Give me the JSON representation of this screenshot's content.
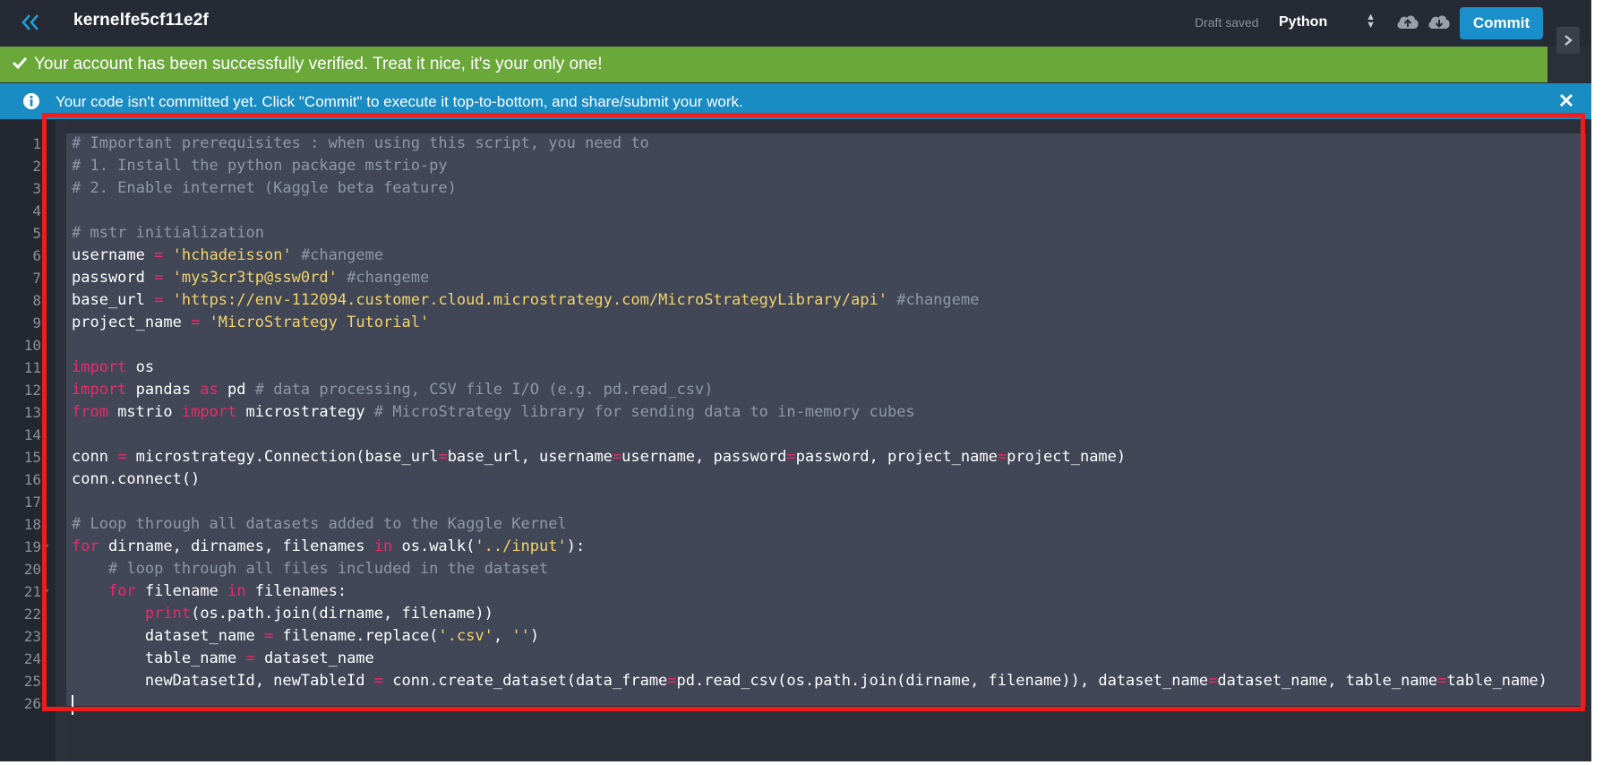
{
  "header": {
    "kernel_title": "kernelfe5cf11e2f",
    "draft_status": "Draft saved",
    "language": "Python",
    "commit_label": "Commit"
  },
  "banners": {
    "success": "Your account has been successfully verified. Treat it nice, it's your only one!",
    "info": "Your code isn't committed yet. Click \"Commit\" to execute it top-to-bottom, and share/submit your work."
  },
  "editor": {
    "lines": [
      {
        "n": "1",
        "tokens": [
          {
            "c": "# Important prerequisites : when using this script, you need to",
            "t": "c"
          }
        ]
      },
      {
        "n": "2",
        "tokens": [
          {
            "c": "# 1. Install the python package mstrio-py",
            "t": "c"
          }
        ]
      },
      {
        "n": "3",
        "tokens": [
          {
            "c": "# 2. Enable internet (Kaggle beta feature)",
            "t": "c"
          }
        ]
      },
      {
        "n": "4",
        "tokens": []
      },
      {
        "n": "5",
        "tokens": [
          {
            "c": "# mstr initialization",
            "t": "c"
          }
        ]
      },
      {
        "n": "6",
        "tokens": [
          {
            "c": "username ",
            "t": "p"
          },
          {
            "c": "=",
            "t": "o"
          },
          {
            "c": " ",
            "t": "p"
          },
          {
            "c": "'hchadeisson'",
            "t": "s"
          },
          {
            "c": " ",
            "t": "p"
          },
          {
            "c": "#changeme",
            "t": "c"
          }
        ]
      },
      {
        "n": "7",
        "tokens": [
          {
            "c": "password ",
            "t": "p"
          },
          {
            "c": "=",
            "t": "o"
          },
          {
            "c": " ",
            "t": "p"
          },
          {
            "c": "'mys3cr3tp@ssw0rd'",
            "t": "s"
          },
          {
            "c": " ",
            "t": "p"
          },
          {
            "c": "#changeme",
            "t": "c"
          }
        ]
      },
      {
        "n": "8",
        "tokens": [
          {
            "c": "base_url ",
            "t": "p"
          },
          {
            "c": "=",
            "t": "o"
          },
          {
            "c": " ",
            "t": "p"
          },
          {
            "c": "'https://env-112094.customer.cloud.microstrategy.com/MicroStrategyLibrary/api'",
            "t": "s"
          },
          {
            "c": " ",
            "t": "p"
          },
          {
            "c": "#changeme",
            "t": "c"
          }
        ]
      },
      {
        "n": "9",
        "tokens": [
          {
            "c": "project_name ",
            "t": "p"
          },
          {
            "c": "=",
            "t": "o"
          },
          {
            "c": " ",
            "t": "p"
          },
          {
            "c": "'MicroStrategy Tutorial'",
            "t": "s"
          }
        ]
      },
      {
        "n": "10",
        "tokens": []
      },
      {
        "n": "11",
        "tokens": [
          {
            "c": "import",
            "t": "k"
          },
          {
            "c": " os",
            "t": "p"
          }
        ]
      },
      {
        "n": "12",
        "tokens": [
          {
            "c": "import",
            "t": "k"
          },
          {
            "c": " pandas ",
            "t": "p"
          },
          {
            "c": "as",
            "t": "k"
          },
          {
            "c": " pd ",
            "t": "p"
          },
          {
            "c": "# data processing, CSV file I/O (e.g. pd.read_csv)",
            "t": "c"
          }
        ]
      },
      {
        "n": "13",
        "tokens": [
          {
            "c": "from",
            "t": "k"
          },
          {
            "c": " mstrio ",
            "t": "p"
          },
          {
            "c": "import",
            "t": "k"
          },
          {
            "c": " microstrategy ",
            "t": "p"
          },
          {
            "c": "# MicroStrategy library for sending data to in-memory cubes",
            "t": "c"
          }
        ]
      },
      {
        "n": "14",
        "tokens": []
      },
      {
        "n": "15",
        "tokens": [
          {
            "c": "conn ",
            "t": "p"
          },
          {
            "c": "=",
            "t": "o"
          },
          {
            "c": " microstrategy.Connection(base_url",
            "t": "p"
          },
          {
            "c": "=",
            "t": "o"
          },
          {
            "c": "base_url, username",
            "t": "p"
          },
          {
            "c": "=",
            "t": "o"
          },
          {
            "c": "username, password",
            "t": "p"
          },
          {
            "c": "=",
            "t": "o"
          },
          {
            "c": "password, project_name",
            "t": "p"
          },
          {
            "c": "=",
            "t": "o"
          },
          {
            "c": "project_name)",
            "t": "p"
          }
        ]
      },
      {
        "n": "16",
        "tokens": [
          {
            "c": "conn.connect()",
            "t": "p"
          }
        ]
      },
      {
        "n": "17",
        "tokens": []
      },
      {
        "n": "18",
        "tokens": [
          {
            "c": "# Loop through all datasets added to the Kaggle Kernel",
            "t": "c"
          }
        ]
      },
      {
        "n": "19",
        "tokens": [
          {
            "c": "for",
            "t": "k"
          },
          {
            "c": " dirname, dirnames, filenames ",
            "t": "p"
          },
          {
            "c": "in",
            "t": "k"
          },
          {
            "c": " os.walk(",
            "t": "p"
          },
          {
            "c": "'../input'",
            "t": "s"
          },
          {
            "c": "):",
            "t": "p"
          }
        ]
      },
      {
        "n": "20",
        "tokens": [
          {
            "c": "    ",
            "t": "p"
          },
          {
            "c": "# loop through all files included in the dataset",
            "t": "c"
          }
        ]
      },
      {
        "n": "21",
        "tokens": [
          {
            "c": "    ",
            "t": "p"
          },
          {
            "c": "for",
            "t": "k"
          },
          {
            "c": " filename ",
            "t": "p"
          },
          {
            "c": "in",
            "t": "k"
          },
          {
            "c": " filenames:",
            "t": "p"
          }
        ]
      },
      {
        "n": "22",
        "tokens": [
          {
            "c": "        ",
            "t": "p"
          },
          {
            "c": "print",
            "t": "k"
          },
          {
            "c": "(os.path.join(dirname, filename))",
            "t": "p"
          }
        ]
      },
      {
        "n": "23",
        "tokens": [
          {
            "c": "        dataset_name ",
            "t": "p"
          },
          {
            "c": "=",
            "t": "o"
          },
          {
            "c": " filename.replace(",
            "t": "p"
          },
          {
            "c": "'.csv'",
            "t": "s"
          },
          {
            "c": ", ",
            "t": "p"
          },
          {
            "c": "''",
            "t": "s"
          },
          {
            "c": ")",
            "t": "p"
          }
        ]
      },
      {
        "n": "24",
        "tokens": [
          {
            "c": "        table_name ",
            "t": "p"
          },
          {
            "c": "=",
            "t": "o"
          },
          {
            "c": " dataset_name",
            "t": "p"
          }
        ]
      },
      {
        "n": "25",
        "tokens": [
          {
            "c": "        newDatasetId, newTableId ",
            "t": "p"
          },
          {
            "c": "=",
            "t": "o"
          },
          {
            "c": " conn.create_dataset(data_frame",
            "t": "p"
          },
          {
            "c": "=",
            "t": "o"
          },
          {
            "c": "pd.read_csv(os.path.join(dirname, filename)), dataset_name",
            "t": "p"
          },
          {
            "c": "=",
            "t": "o"
          },
          {
            "c": "dataset_name, table_name",
            "t": "p"
          },
          {
            "c": "=",
            "t": "o"
          },
          {
            "c": "table_name)",
            "t": "p"
          }
        ]
      },
      {
        "n": "26",
        "tokens": []
      }
    ]
  },
  "icons": {
    "back": "double-chevron-left-icon",
    "upload": "cloud-upload-icon",
    "download": "cloud-download-icon",
    "success": "checkmark-icon",
    "info": "info-circle-icon",
    "close": "close-icon",
    "panel": "chevron-right-icon"
  },
  "colors": {
    "accent": "#1b8fc9",
    "success_banner": "#6aa83a",
    "info_banner": "#1a8cc4",
    "highlight_frame": "#ef1c1c",
    "keyword": "#ec2a6a",
    "string": "#f1d36b",
    "comment": "#8f98a8"
  }
}
